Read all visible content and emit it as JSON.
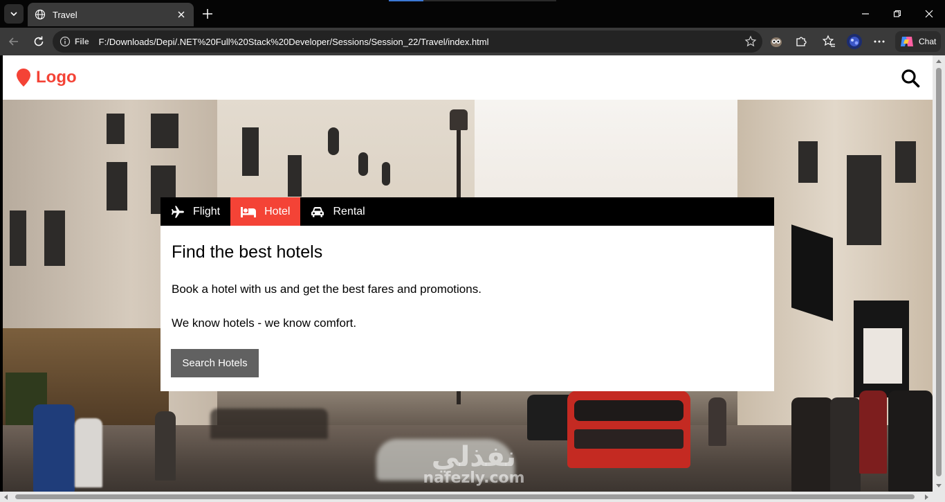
{
  "browser": {
    "tab_title": "Travel",
    "address_label": "File",
    "url": "F:/Downloads/Depi/.NET%20Full%20Stack%20Developer/Sessions/Session_22/Travel/index.html",
    "chat_label": "Chat",
    "icons": {
      "tab_list": "chevron-down-icon",
      "tab_favicon": "globe-icon",
      "tab_close": "close-icon",
      "new_tab": "plus-icon",
      "minimize": "minimize-icon",
      "restore": "restore-icon",
      "close_window": "close-icon",
      "back": "arrow-left-icon",
      "refresh": "refresh-icon",
      "site_info": "info-icon",
      "favorite": "star-icon",
      "extension_1": "owl-icon",
      "extensions": "puzzle-icon",
      "favorites": "favorites-star-icon",
      "profile": "avatar",
      "more": "ellipsis-icon",
      "copilot": "copilot-icon"
    }
  },
  "site": {
    "logo_text": "Logo",
    "logo_icon": "map-marker-icon",
    "search_icon": "search-icon",
    "accent_color": "#f44336"
  },
  "booking": {
    "tabs": [
      {
        "label": "Flight",
        "icon": "plane-icon",
        "active": false
      },
      {
        "label": "Hotel",
        "icon": "bed-icon",
        "active": true
      },
      {
        "label": "Rental",
        "icon": "car-icon",
        "active": false
      }
    ],
    "title": "Find the best hotels",
    "paragraph_1": "Book a hotel with us and get the best fares and promotions.",
    "paragraph_2": "We know hotels - we know comfort.",
    "button_label": "Search Hotels",
    "button_color": "#616161"
  },
  "watermark": {
    "arabic": "نفذلي",
    "latin": "nafezly.com"
  }
}
